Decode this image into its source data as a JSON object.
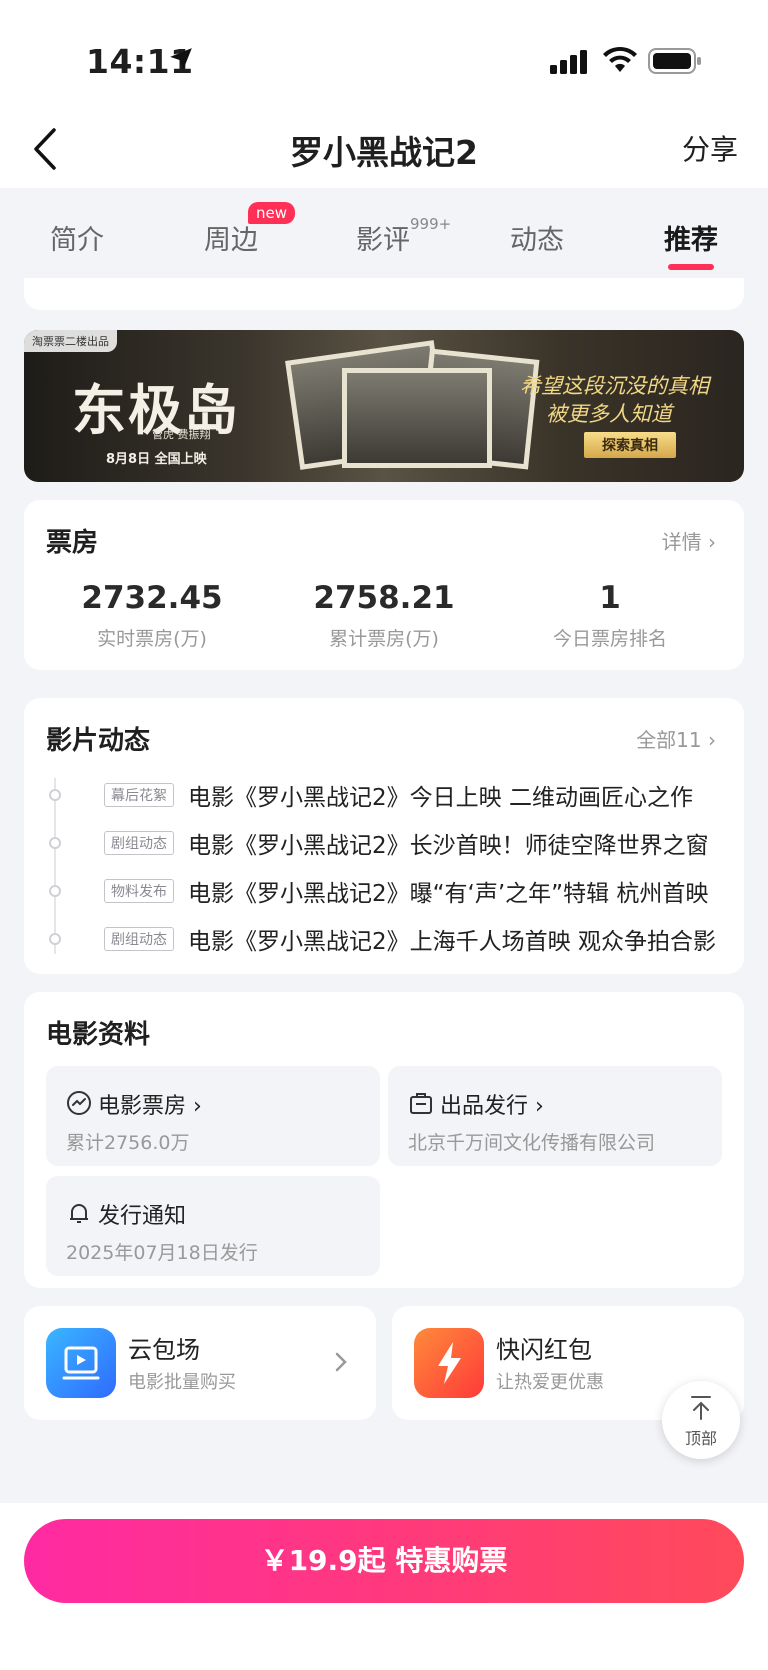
{
  "status_bar": {
    "time": "14:11"
  },
  "nav": {
    "title": "罗小黑战记2",
    "share": "分享"
  },
  "tabs": [
    {
      "label": "简介"
    },
    {
      "label": "周边",
      "badge": "new"
    },
    {
      "label": "影评",
      "count": "999+"
    },
    {
      "label": "动态"
    },
    {
      "label": "推荐",
      "active": true
    }
  ],
  "banner": {
    "tag": "淘票票二楼出品",
    "movie_title": "东极岛",
    "credits": "管虎 费振翔",
    "release": "8月8日 全国上映",
    "slogan_line1": "希望这段沉没的真相",
    "slogan_line2": "被更多人知道",
    "button": "探索真相"
  },
  "box_office": {
    "title": "票房",
    "more": "详情",
    "stats": [
      {
        "value": "2732.45",
        "label": "实时票房(万)"
      },
      {
        "value": "2758.21",
        "label": "累计票房(万)"
      },
      {
        "value": "1",
        "label": "今日票房排名"
      }
    ]
  },
  "news": {
    "title": "影片动态",
    "more": "全部11",
    "items": [
      {
        "tag": "幕后花絮",
        "text": "电影《罗小黑战记2》今日上映 二维动画匠心之作"
      },
      {
        "tag": "剧组动态",
        "text": "电影《罗小黑战记2》长沙首映！师徒空降世界之窗"
      },
      {
        "tag": "物料发布",
        "text": "电影《罗小黑战记2》曝“有‘声’之年”特辑 杭州首映"
      },
      {
        "tag": "剧组动态",
        "text": "电影《罗小黑战记2》上海千人场首映 观众争拍合影"
      }
    ]
  },
  "info": {
    "title": "电影资料",
    "tiles": [
      {
        "title": "电影票房",
        "sub": "累计2756.0万",
        "icon": "trend-icon"
      },
      {
        "title": "出品发行",
        "sub": "北京千万间文化传播有限公司",
        "icon": "briefcase-icon"
      },
      {
        "title": "发行通知",
        "sub": "2025年07月18日发行",
        "icon": "bell-icon"
      }
    ]
  },
  "promos": [
    {
      "title": "云包场",
      "sub": "电影批量购买",
      "icon": "cinema-icon",
      "color": "#2f8cff"
    },
    {
      "title": "快闪红包",
      "sub": "让热爱更优惠",
      "icon": "lightning-icon",
      "color": "#ff5a3a"
    }
  ],
  "back_to_top": "顶部",
  "buy_button": "￥19.9起 特惠购票",
  "colors": {
    "accent": "#ff2f56",
    "buy_gradient_start": "#ff2aa2",
    "buy_gradient_end": "#ff4a5a"
  }
}
